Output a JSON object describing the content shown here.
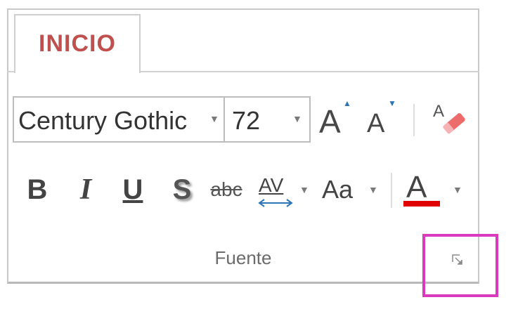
{
  "ribbon": {
    "tab": {
      "label": "INICIO",
      "accent": "#c0504d"
    },
    "font_group": {
      "font_name": {
        "value": "Century Gothic"
      },
      "font_size": {
        "value": "72"
      },
      "grow_font": {
        "letter": "A",
        "icon": "grow-font-icon"
      },
      "shrink_font": {
        "letter": "A",
        "icon": "shrink-font-icon"
      },
      "clear_formatting": {
        "icon": "clear-formatting-icon"
      },
      "bold": {
        "label": "B"
      },
      "italic": {
        "label": "I"
      },
      "underline": {
        "label": "U"
      },
      "shadow": {
        "label": "S"
      },
      "strikethrough": {
        "label": "abc"
      },
      "character_spacing": {
        "label": "AV"
      },
      "change_case": {
        "label": "Aa"
      },
      "font_color": {
        "letter": "A",
        "color": "#e00000"
      },
      "group_label": "Fuente",
      "dialog_launcher": {
        "icon": "dialog-launcher-icon",
        "highlight_color": "#d93bbf"
      }
    }
  }
}
